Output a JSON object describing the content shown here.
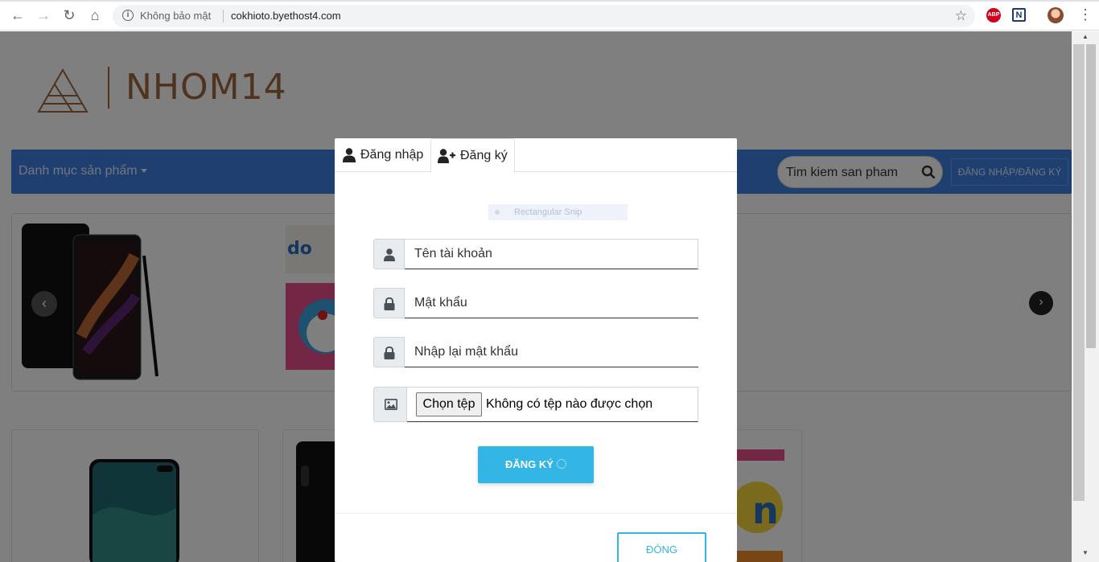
{
  "browser": {
    "security_label": "Không bảo mật",
    "url": "cokhioto.byethost4.com",
    "ext_abp": "ABP",
    "ext_n": "N"
  },
  "site": {
    "logo_text": "NHOM14",
    "nav_category": "Danh mục sản phẩm",
    "search_placeholder": "Tim kiem san pham",
    "login_register": "ĐĂNG NHẬP/ĐĂNG KÝ"
  },
  "modal": {
    "tabs": [
      {
        "label": "Đăng nhập",
        "icon": "user-icon"
      },
      {
        "label": "Đăng ký",
        "icon": "user-plus-icon"
      }
    ],
    "snip_label": "Rectangular Snip",
    "fields": {
      "username_placeholder": "Tên tài khoản",
      "password_placeholder": "Mật khẩu",
      "confirm_placeholder": "Nhập lại mật khẩu"
    },
    "file": {
      "button": "Chọn tệp",
      "status": "Không có tệp nào được chọn"
    },
    "register_button": "ĐĂNG KÝ",
    "close_button": "ĐÓNG"
  },
  "colors": {
    "nav_blue": "#3f7fe0",
    "accent_cyan": "#33b5e5",
    "logo_brown": "#a0663f"
  }
}
